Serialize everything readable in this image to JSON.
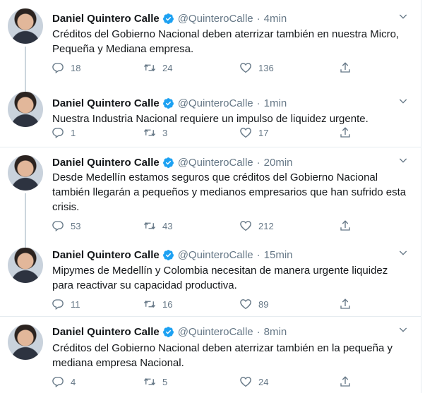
{
  "author": {
    "name": "Daniel Quintero Calle",
    "handle": "@QuinteroCalle"
  },
  "colors": {
    "verified": "#1da1f2",
    "meta_text": "#657786",
    "body_text": "#14171a",
    "divider": "#e6ecf0",
    "thread_line": "#ccd6dd"
  },
  "icons": {
    "reply": "speech-bubble",
    "retweet": "retweet-arrows",
    "like": "heart-outline",
    "share": "upload-arrow",
    "more": "chevron-down",
    "verified": "verified-badge"
  },
  "tweets": [
    {
      "time": "4min",
      "text": "Créditos del Gobierno Nacional deben aterrizar también en nuestra Micro, Pequeña y Mediana empresa.",
      "replies": "18",
      "retweets": "24",
      "likes": "136"
    },
    {
      "time": "1min",
      "text": "Nuestra Industria Nacional requiere un impulso de liquidez urgente.",
      "replies": "1",
      "retweets": "3",
      "likes": "17"
    },
    {
      "time": "20min",
      "text": "Desde Medellín estamos seguros que  créditos del Gobierno Nacional también llegarán a pequeños y medianos empresarios que han sufrido esta crisis.",
      "replies": "53",
      "retweets": "43",
      "likes": "212"
    },
    {
      "time": "15min",
      "text": "Mipymes de Medellín y Colombia  necesitan de manera urgente  liquidez para reactivar su capacidad productiva.",
      "replies": "11",
      "retweets": "16",
      "likes": "89"
    },
    {
      "time": "8min",
      "text": "Créditos del Gobierno Nacional deben aterrizar también en la pequeña y mediana empresa Nacional.",
      "replies": "4",
      "retweets": "5",
      "likes": "24"
    }
  ]
}
